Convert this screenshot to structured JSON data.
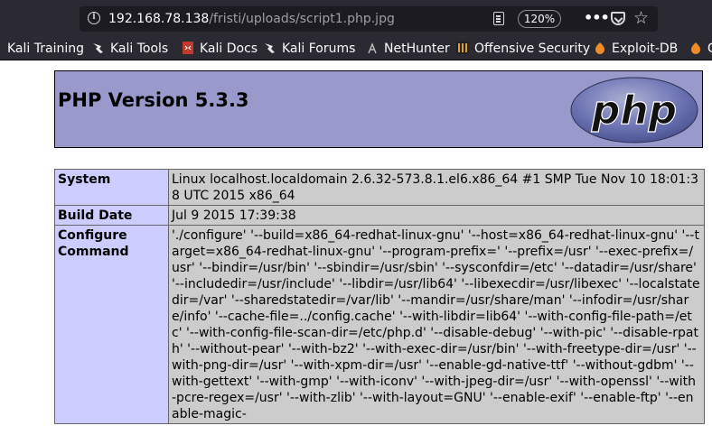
{
  "browser": {
    "url_host": "192.168.78.138",
    "url_path": "/fristi/uploads/script1.php.jpg",
    "zoom": "120%",
    "icons": [
      "site-info-icon",
      "reader-view-icon",
      "more-actions-icon",
      "pocket-icon",
      "bookmark-star-icon"
    ]
  },
  "bookmarks": [
    {
      "label": "Kali Training",
      "icon": "kali-dragon-icon"
    },
    {
      "label": "Kali Tools",
      "icon": "kali-dragon-icon"
    },
    {
      "label": "Kali Docs",
      "icon": "kali-docs-icon"
    },
    {
      "label": "Kali Forums",
      "icon": "kali-dragon-icon"
    },
    {
      "label": "NetHunter",
      "icon": "nethunter-icon"
    },
    {
      "label": "Offensive Security",
      "icon": "offsec-icon"
    },
    {
      "label": "Exploit-DB",
      "icon": "exploit-db-icon"
    },
    {
      "label": "G",
      "icon": "exploit-db-icon"
    }
  ],
  "page": {
    "title": "PHP Version 5.3.3",
    "logo_text": "php",
    "colors": {
      "header_bg": "#9999cc",
      "key_bg": "#ccccff",
      "value_bg": "#cccccc"
    }
  },
  "info_rows": [
    {
      "key": "System",
      "value": "Linux localhost.localdomain 2.6.32-573.8.1.el6.x86_64 #1 SMP Tue Nov 10 18:01:38 UTC 2015 x86_64"
    },
    {
      "key": "Build Date",
      "value": "Jul 9 2015 17:39:38"
    },
    {
      "key": "Configure Command",
      "value": "'./configure' '--build=x86_64-redhat-linux-gnu' '--host=x86_64-redhat-linux-gnu' '--target=x86_64-redhat-linux-gnu' '--program-prefix=' '--prefix=/usr' '--exec-prefix=/usr' '--bindir=/usr/bin' '--sbindir=/usr/sbin' '--sysconfdir=/etc' '--datadir=/usr/share' '--includedir=/usr/include' '--libdir=/usr/lib64' '--libexecdir=/usr/libexec' '--localstatedir=/var' '--sharedstatedir=/var/lib' '--mandir=/usr/share/man' '--infodir=/usr/share/info' '--cache-file=../config.cache' '--with-libdir=lib64' '--with-config-file-path=/etc' '--with-config-file-scan-dir=/etc/php.d' '--disable-debug' '--with-pic' '--disable-rpath' '--without-pear' '--with-bz2' '--with-exec-dir=/usr/bin' '--with-freetype-dir=/usr' '--with-png-dir=/usr' '--with-xpm-dir=/usr' '--enable-gd-native-ttf' '--without-gdbm' '--with-gettext' '--with-gmp' '--with-iconv' '--with-jpeg-dir=/usr' '--with-openssl' '--with-pcre-regex=/usr' '--with-zlib' '--with-layout=GNU' '--enable-exif' '--enable-ftp' '--enable-magic-"
    }
  ]
}
